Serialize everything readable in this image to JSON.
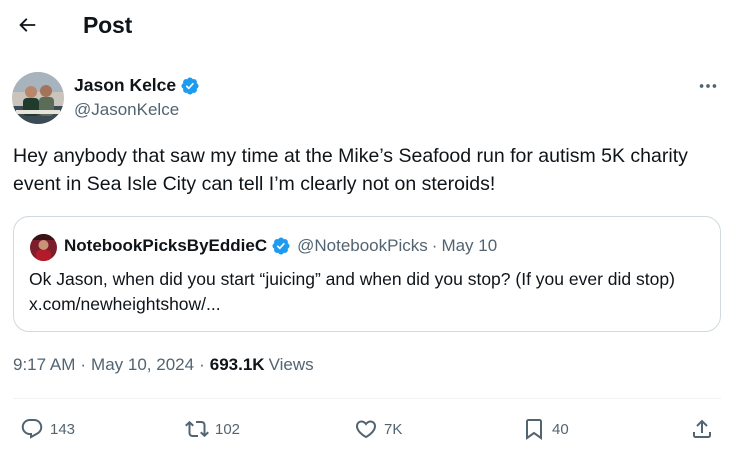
{
  "header": {
    "title": "Post"
  },
  "author": {
    "name": "Jason Kelce",
    "handle": "@JasonKelce",
    "verified": true
  },
  "tweet": {
    "text": "Hey anybody that saw my time at the Mike’s Seafood run for autism 5K charity event in Sea Isle City can tell I’m clearly not on steroids!"
  },
  "quote": {
    "name": "NotebookPicksByEddieC",
    "handle": "@NotebookPicks",
    "separator": "·",
    "date": "May 10",
    "text": "Ok Jason, when did you start “juicing” and when did you stop? (If you ever did stop) x.com/newheightshow/..."
  },
  "meta": {
    "time": "9:17 AM",
    "sep1": "·",
    "date": "May 10, 2024",
    "sep2": "·",
    "views_count": "693.1K",
    "views_label": "Views"
  },
  "actions": {
    "replies": "143",
    "reposts": "102",
    "likes": "7K",
    "bookmarks": "40"
  },
  "colors": {
    "verified": "#1d9bf0",
    "text_primary": "#0f1419",
    "text_secondary": "#536471",
    "border": "#cfd9de"
  },
  "icons": {
    "back": "arrow-left-icon",
    "verified": "verified-badge-icon",
    "more": "more-horizontal-icon",
    "reply": "reply-icon",
    "repost": "repost-icon",
    "like": "heart-icon",
    "bookmark": "bookmark-icon",
    "share": "share-icon"
  }
}
